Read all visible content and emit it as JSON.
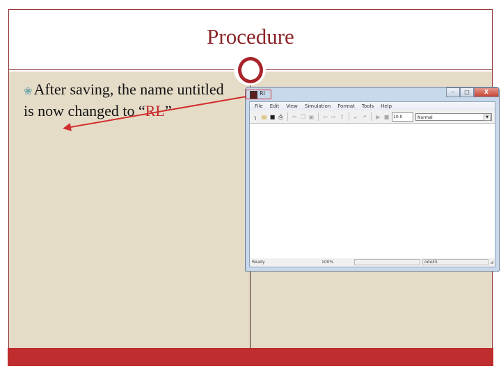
{
  "slide": {
    "title": "Procedure",
    "bullet": {
      "glyph": "❀",
      "text_before": "After saving, the name untitled is now changed to “",
      "highlight": "RL",
      "text_after": "”"
    },
    "colors": {
      "title": "#8c2428",
      "accent": "#c02d2e",
      "body_bg": "#e5dcc8",
      "highlight_text": "#c0282a",
      "annotation": "#d12e2e"
    }
  },
  "window": {
    "title": "RI",
    "buttons": {
      "minimize": "–",
      "maximize": "□",
      "close": "X"
    },
    "menu": [
      "File",
      "Edit",
      "View",
      "Simulation",
      "Format",
      "Tools",
      "Help"
    ],
    "toolbar": {
      "icons": [
        "new-icon",
        "open-icon",
        "save-icon",
        "print-icon",
        "cut-icon",
        "copy-icon",
        "paste-icon",
        "back-icon",
        "forward-icon",
        "up-icon",
        "undo-icon",
        "redo-icon",
        "start-icon",
        "stop-icon"
      ],
      "stop_time": "10.0",
      "sim_mode": "Normal"
    },
    "status": {
      "state": "Ready",
      "zoom": "100%",
      "solver": "ode45"
    }
  }
}
